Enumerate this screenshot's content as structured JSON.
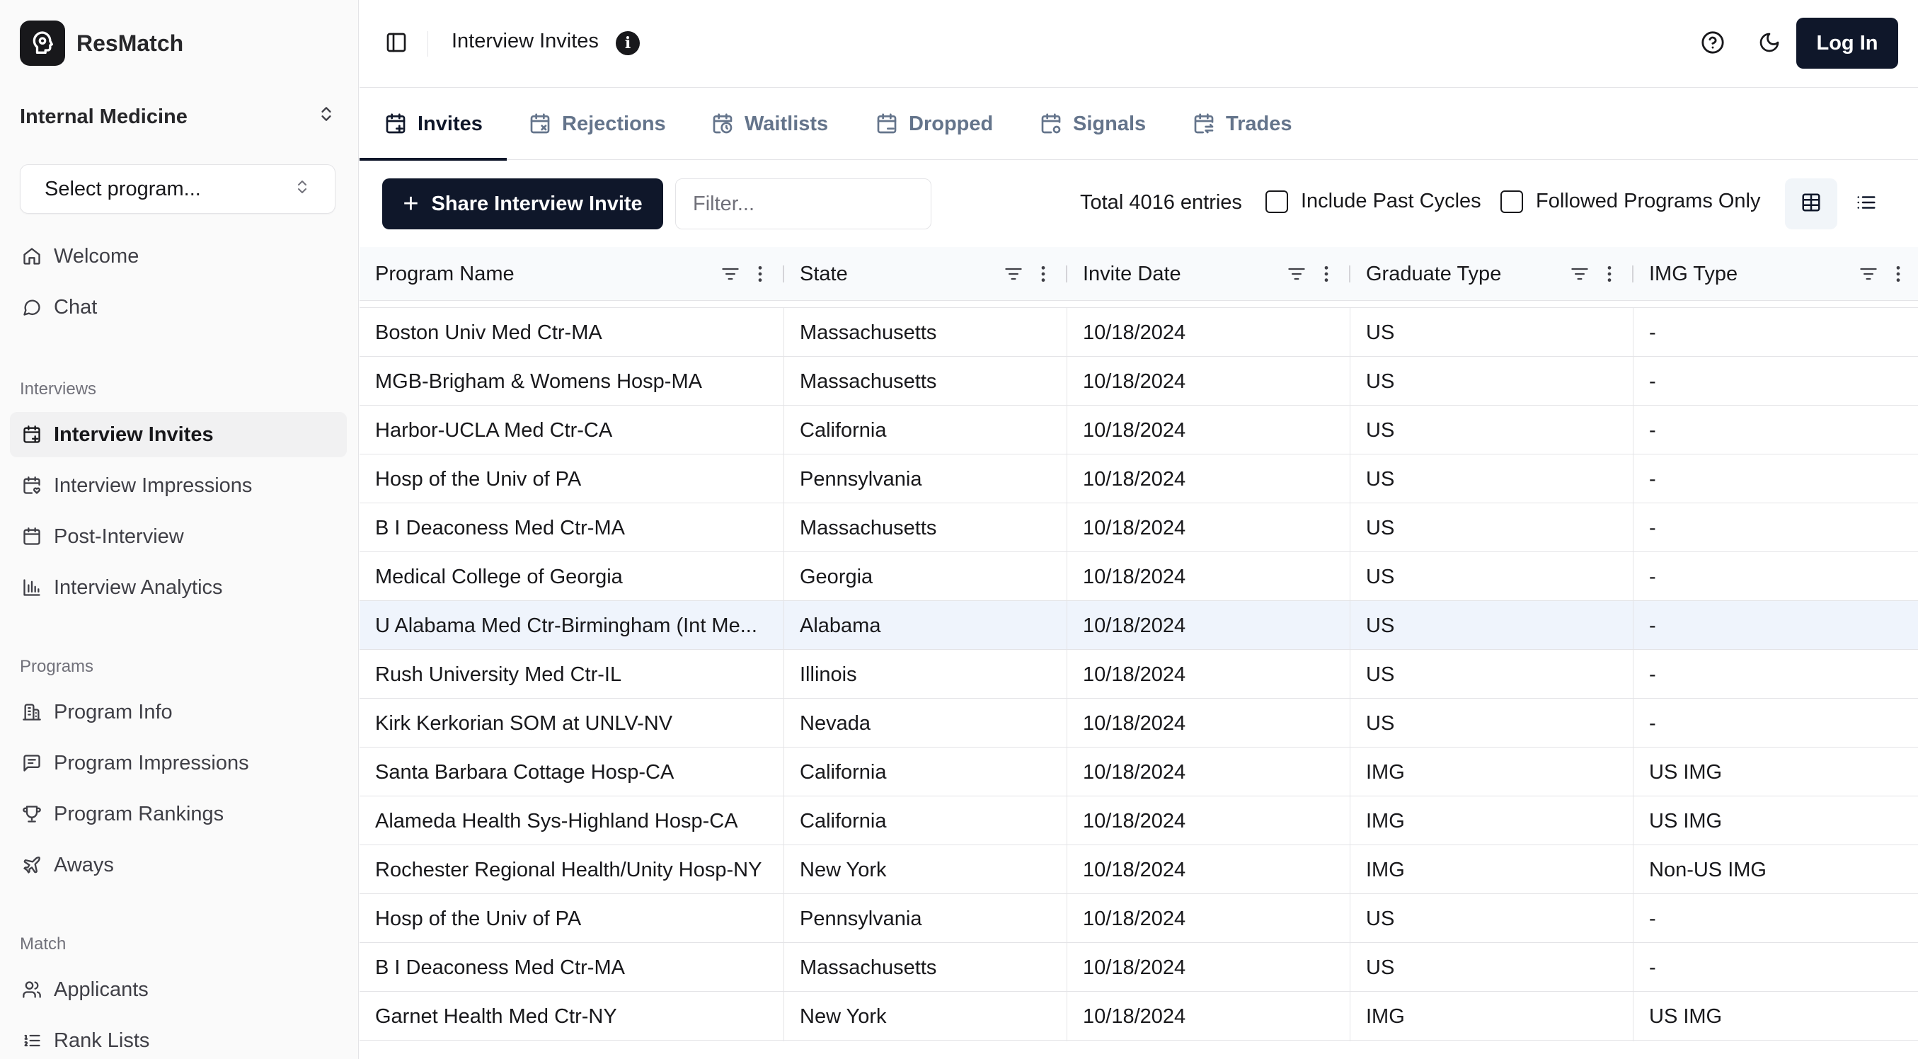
{
  "app": {
    "name": "ResMatch",
    "specialty": "Internal Medicine",
    "program_select_placeholder": "Select program..."
  },
  "sidebar": {
    "top_items": [
      {
        "label": "Welcome",
        "icon": "home-icon"
      },
      {
        "label": "Chat",
        "icon": "chat-icon"
      }
    ],
    "sections": [
      {
        "title": "Interviews",
        "items": [
          {
            "label": "Interview Invites",
            "icon": "calendar-plus-icon",
            "active": true
          },
          {
            "label": "Interview Impressions",
            "icon": "calendar-heart-icon"
          },
          {
            "label": "Post-Interview",
            "icon": "calendar-icon"
          },
          {
            "label": "Interview Analytics",
            "icon": "bar-chart-icon"
          }
        ]
      },
      {
        "title": "Programs",
        "items": [
          {
            "label": "Program Info",
            "icon": "building-icon"
          },
          {
            "label": "Program Impressions",
            "icon": "message-icon"
          },
          {
            "label": "Program Rankings",
            "icon": "trophy-icon"
          },
          {
            "label": "Aways",
            "icon": "plane-icon"
          }
        ]
      },
      {
        "title": "Match",
        "items": [
          {
            "label": "Applicants",
            "icon": "users-icon"
          },
          {
            "label": "Rank Lists",
            "icon": "list-ordered-icon"
          }
        ]
      }
    ]
  },
  "header": {
    "title": "Interview Invites",
    "login_label": "Log In"
  },
  "tabs": [
    {
      "label": "Invites",
      "active": true
    },
    {
      "label": "Rejections"
    },
    {
      "label": "Waitlists"
    },
    {
      "label": "Dropped"
    },
    {
      "label": "Signals"
    },
    {
      "label": "Trades"
    }
  ],
  "toolbar": {
    "share_label": "Share Interview Invite",
    "filter_placeholder": "Filter...",
    "total_label": "Total 4016 entries",
    "include_past_label": "Include Past Cycles",
    "followed_only_label": "Followed Programs Only"
  },
  "table": {
    "columns": [
      "Program Name",
      "State",
      "Invite Date",
      "Graduate Type",
      "IMG Type"
    ],
    "rows": [
      [
        "Boston Univ Med Ctr-MA",
        "Massachusetts",
        "10/18/2024",
        "US",
        "-"
      ],
      [
        "MGB-Brigham & Womens Hosp-MA",
        "Massachusetts",
        "10/18/2024",
        "US",
        "-"
      ],
      [
        "Harbor-UCLA Med Ctr-CA",
        "California",
        "10/18/2024",
        "US",
        "-"
      ],
      [
        "Hosp of the Univ of PA",
        "Pennsylvania",
        "10/18/2024",
        "US",
        "-"
      ],
      [
        "B I Deaconess Med Ctr-MA",
        "Massachusetts",
        "10/18/2024",
        "US",
        "-"
      ],
      [
        "Medical College of Georgia",
        "Georgia",
        "10/18/2024",
        "US",
        "-"
      ],
      [
        "U Alabama Med Ctr-Birmingham (Int Me...",
        "Alabama",
        "10/18/2024",
        "US",
        "-"
      ],
      [
        "Rush University Med Ctr-IL",
        "Illinois",
        "10/18/2024",
        "US",
        "-"
      ],
      [
        "Kirk Kerkorian SOM at UNLV-NV",
        "Nevada",
        "10/18/2024",
        "US",
        "-"
      ],
      [
        "Santa Barbara Cottage Hosp-CA",
        "California",
        "10/18/2024",
        "IMG",
        "US IMG"
      ],
      [
        "Alameda Health Sys-Highland Hosp-CA",
        "California",
        "10/18/2024",
        "IMG",
        "US IMG"
      ],
      [
        "Rochester Regional Health/Unity Hosp-NY",
        "New York",
        "10/18/2024",
        "IMG",
        "Non-US IMG"
      ],
      [
        "Hosp of the Univ of PA",
        "Pennsylvania",
        "10/18/2024",
        "US",
        "-"
      ],
      [
        "B I Deaconess Med Ctr-MA",
        "Massachusetts",
        "10/18/2024",
        "US",
        "-"
      ],
      [
        "Garnet Health Med Ctr-NY",
        "New York",
        "10/18/2024",
        "IMG",
        "US IMG"
      ]
    ],
    "highlighted_row": 6
  }
}
